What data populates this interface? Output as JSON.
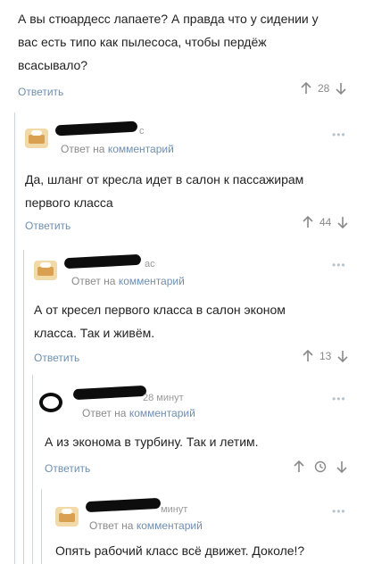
{
  "post": {
    "text_line1": "А вы стюардесс лапаете? А правда что у сидении у",
    "text_line2": "вас есть типо как пылесоса, чтобы пердёж",
    "text_line3": "всасывало?",
    "reply_label": "Ответить",
    "votes": "28"
  },
  "comments": [
    {
      "name_tail": "с",
      "meta_prefix": "Ответ на",
      "meta_link": "комментарий",
      "text_line1": "Да, шланг от кресла идет в салон к пассажирам",
      "text_line2": "первого класса",
      "reply_label": "Ответить",
      "votes": "44",
      "dots": "•••"
    },
    {
      "name_tail": "ас",
      "meta_prefix": "Ответ на",
      "meta_link": "комментарий",
      "text_line1": "А от кресел первого класса в салон эконом",
      "text_line2": "класса. Так и живём.",
      "reply_label": "Ответить",
      "votes": "13",
      "dots": "•••"
    },
    {
      "name_tail": "28 минут",
      "meta_prefix": "Ответ на",
      "meta_link": "комментарий",
      "text_line1": "А из эконома в турбину. Так и летим.",
      "reply_label": "Ответить",
      "dots": "•••"
    },
    {
      "name_tail": "минут",
      "meta_prefix": "Ответ на",
      "meta_link": "комментарий",
      "text_line1": "Опять рабочий класс всё движет. Доколе!?",
      "dots": "•••"
    }
  ],
  "icons": {
    "up": "arrow-up-icon",
    "down": "arrow-down-icon",
    "save": "clock-icon"
  },
  "colors": {
    "link": "#6f8fb0",
    "thread_line": "#cfd6dc"
  }
}
